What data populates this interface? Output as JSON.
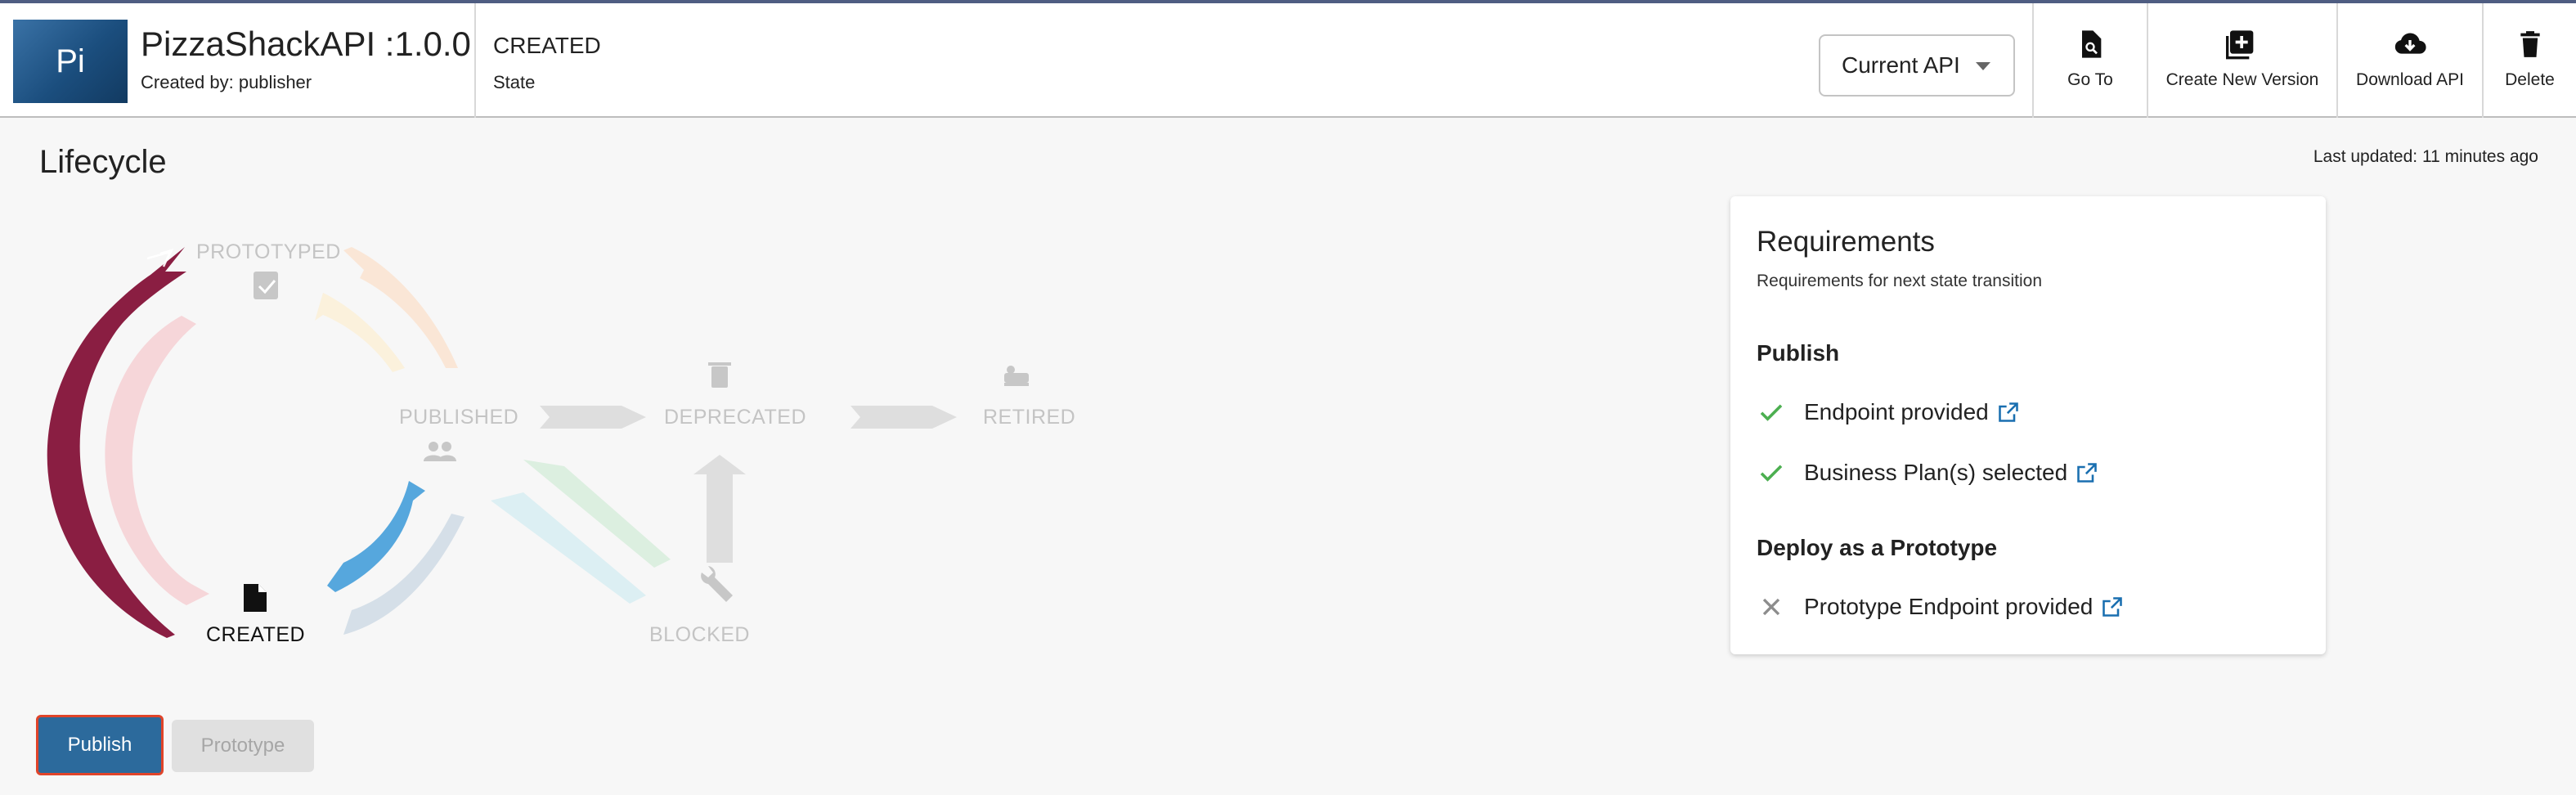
{
  "header": {
    "avatar_text": "Pi",
    "api_title": "PizzaShackAPI :1.0.0",
    "created_by": "Created by: publisher",
    "state_value": "CREATED",
    "state_label": "State",
    "version_select": "Current API",
    "actions": {
      "goto": "Go To",
      "create_version": "Create New Version",
      "download": "Download API",
      "delete": "Delete"
    }
  },
  "page": {
    "title": "Lifecycle",
    "last_updated": "Last updated: 11 minutes ago"
  },
  "lifecycle": {
    "current_state": "CREATED",
    "states": {
      "prototyped": "PROTOTYPED",
      "published": "PUBLISHED",
      "deprecated": "DEPRECATED",
      "retired": "RETIRED",
      "created": "CREATED",
      "blocked": "BLOCKED"
    }
  },
  "requirements": {
    "title": "Requirements",
    "subtitle": "Requirements for next state transition",
    "sections": [
      {
        "title": "Publish",
        "items": [
          {
            "label": "Endpoint provided",
            "status": "done"
          },
          {
            "label": "Business Plan(s) selected",
            "status": "done"
          }
        ]
      },
      {
        "title": "Deploy as a Prototype",
        "items": [
          {
            "label": "Prototype Endpoint provided",
            "status": "missing"
          }
        ]
      }
    ]
  },
  "actions": {
    "publish": "Publish",
    "prototype": "Prototype"
  },
  "colors": {
    "primary": "#2c6a9c",
    "created_to_prototyped_arrow": "#8a1e42",
    "created_to_published_arrow": "#56a7dd",
    "check_green": "#4caf50",
    "link_blue": "#1a6fb0",
    "highlight_border": "#e0442a"
  }
}
